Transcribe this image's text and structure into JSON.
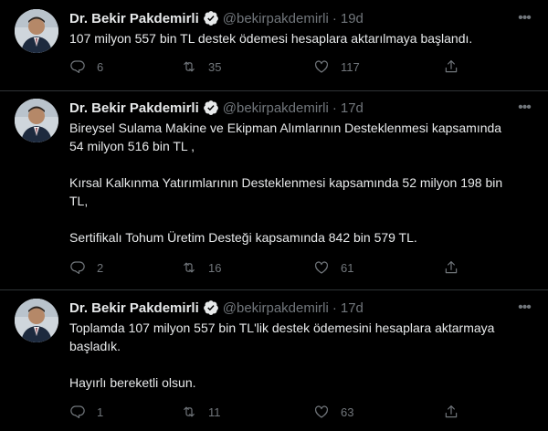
{
  "tweets": [
    {
      "author_name": "Dr. Bekir Pakdemirli",
      "handle": "@bekirpakdemirli",
      "separator": "·",
      "time": "19d",
      "lines": [
        "107 milyon 557 bin TL destek ödemesi hesaplara aktarılmaya başlandı."
      ],
      "replies": "6",
      "retweets": "35",
      "likes": "117"
    },
    {
      "author_name": "Dr. Bekir Pakdemirli",
      "handle": "@bekirpakdemirli",
      "separator": "·",
      "time": "17d",
      "lines": [
        "Bireysel Sulama Makine ve Ekipman Alımlarının Desteklenmesi kapsamında",
        "54 milyon 516 bin TL ,",
        "",
        "Kırsal Kalkınma Yatırımlarının Desteklenmesi kapsamında 52 milyon 198 bin",
        "TL,",
        "",
        "Sertifikalı Tohum Üretim Desteği kapsamında 842 bin 579 TL."
      ],
      "replies": "2",
      "retweets": "16",
      "likes": "61"
    },
    {
      "author_name": "Dr. Bekir Pakdemirli",
      "handle": "@bekirpakdemirli",
      "separator": "·",
      "time": "17d",
      "lines": [
        "Toplamda 107 milyon 557 bin TL'lik destek ödemesini hesaplara aktarmaya",
        "başladık.",
        "",
        "Hayırlı bereketli olsun."
      ],
      "replies": "1",
      "retweets": "11",
      "likes": "63"
    }
  ],
  "icons": {
    "verified": "verified-badge-icon",
    "more": "more-options-icon",
    "reply": "reply-icon",
    "retweet": "retweet-icon",
    "like": "like-icon",
    "share": "share-icon"
  },
  "colors": {
    "background": "#000000",
    "text": "#e7e9ea",
    "muted": "#71767b",
    "verified": "#1d9bf0",
    "divider": "#2f3336"
  }
}
